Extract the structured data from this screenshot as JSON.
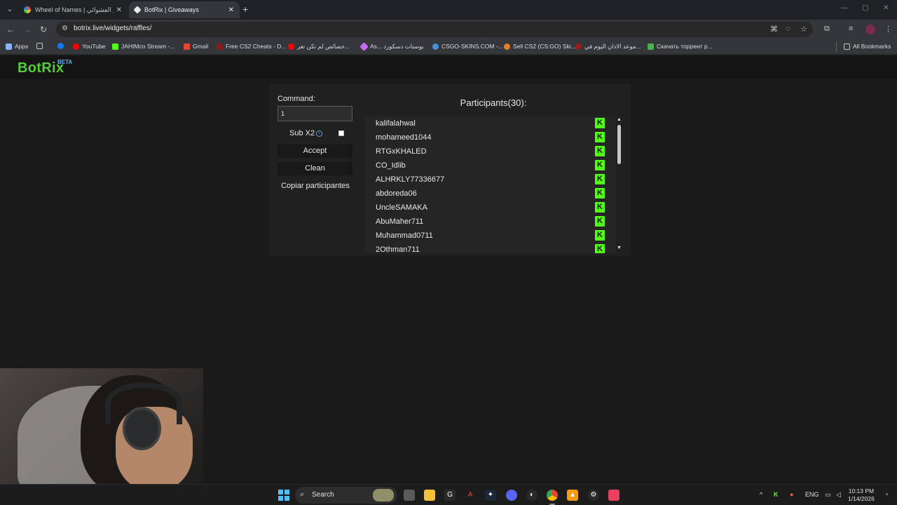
{
  "browser": {
    "tabs": [
      {
        "title": "Wheel of Names | عسم العشوائي",
        "active": false,
        "favicon_color": "#e04a3b"
      },
      {
        "title": "BotRix | Giveaways",
        "active": true,
        "favicon_color": "#e8e8e8"
      }
    ],
    "url": "botrix.live/widgets/raffles/",
    "bookmarks": [
      {
        "label": "Apps",
        "icon_color": "#8ab4f8"
      },
      {
        "label": "",
        "icon_color": "#1877f2"
      },
      {
        "label": "YouTube",
        "icon_color": "#ff0000"
      },
      {
        "label": "JAHIMco Stream -...",
        "icon_color": "#53fc18"
      },
      {
        "label": "Gmail",
        "icon_color": "#ea4335"
      },
      {
        "label": "Free CS2 Cheats - D...",
        "icon_color": "#8b1a1a"
      },
      {
        "label": "خصائص لم تكن تعر...",
        "icon_color": "#ff0000"
      },
      {
        "label": "As... بوستات دسكورد",
        "icon_color": "#c56cf0"
      },
      {
        "label": "CSGO-SKINS.COM -...",
        "icon_color": "#4a90d9"
      },
      {
        "label": "Sell CS2 (CS:GO) Ski...",
        "icon_color": "#e67e22"
      },
      {
        "label": "موعد الاذان اليوم في...",
        "icon_color": "#9b1c1c"
      },
      {
        "label": "Скачать торрент р...",
        "icon_color": "#4caf50"
      },
      {
        "label": "All Bookmarks",
        "icon_color": "#c4c7c5"
      }
    ]
  },
  "site": {
    "logo": "BotRix",
    "logo_badge": "BETA",
    "brand_color": "#52ce39"
  },
  "raffle": {
    "command_label": "Command:",
    "command_value": "1",
    "sub_x2_label": "Sub X2",
    "sub_x2_checked": false,
    "accept_label": "Accept",
    "clean_label": "Clean",
    "copy_label": "Copiar participantes",
    "participants_title": "Participants(30):",
    "platform_icon": "kick-icon",
    "participants": [
      "kalifalahwal",
      "mohameed1044",
      "RTGxKHALED",
      "CO_Idlib",
      "ALHRKLY77336677",
      "abdoreda06",
      "UncleSAMAKA",
      "AbuMaher711",
      "Muhammad0711",
      "2Othman711"
    ]
  },
  "taskbar": {
    "search_label": "Search",
    "language": "ENG",
    "time": "10:13 PM",
    "date": "1/14/2026"
  }
}
